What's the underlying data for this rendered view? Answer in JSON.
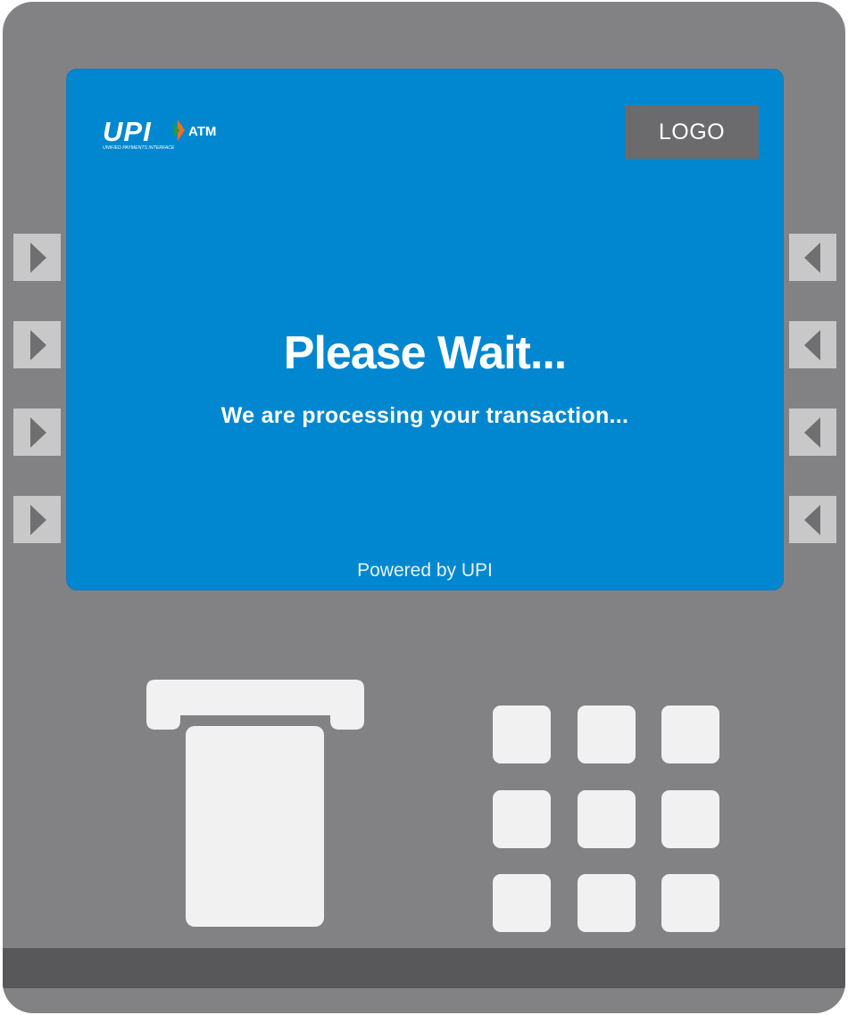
{
  "screen": {
    "brand": {
      "upi_text": "UPI",
      "atm_text": "ATM",
      "tagline": "UNIFIED PAYMENTS INTERFACE"
    },
    "bank_logo_text": "LOGO",
    "title": "Please Wait...",
    "subtitle": "We are processing your transaction...",
    "footer": "Powered by UPI"
  },
  "colors": {
    "machine_body": "#828285",
    "screen_background": "#0087cf",
    "bottom_strip": "#58585a",
    "button_face": "#c8c8c9",
    "key_face": "#f1f1f1",
    "upi_orange": "#e8731d",
    "upi_green": "#2a9a47"
  },
  "side_buttons": {
    "left": [
      "arrow-right-icon",
      "arrow-right-icon",
      "arrow-right-icon",
      "arrow-right-icon"
    ],
    "right": [
      "arrow-left-icon",
      "arrow-left-icon",
      "arrow-left-icon",
      "arrow-left-icon"
    ]
  },
  "keypad": {
    "rows": 3,
    "columns": 3
  }
}
